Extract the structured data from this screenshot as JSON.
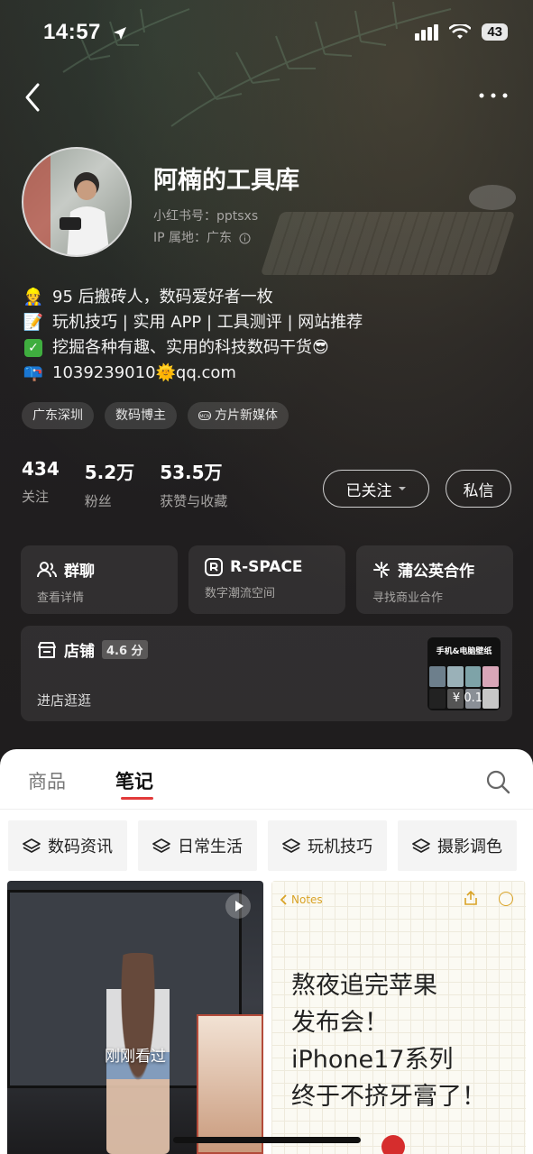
{
  "status_bar": {
    "time": "14:57",
    "battery": "43"
  },
  "profile": {
    "name": "阿楠的工具库",
    "red_id": "小红书号：pptsxs",
    "ip": "IP 属地：广东",
    "bio": [
      {
        "icon": "construction-worker-emoji",
        "text": "95 后搬砖人，数码爱好者一枚"
      },
      {
        "icon": "memo-emoji",
        "text": "玩机技巧 | 实用 APP | 工具测评 |  网站推荐"
      },
      {
        "icon": "check-mark-emoji",
        "text": "挖掘各种有趣、实用的科技数码干货😎"
      },
      {
        "icon": "mailbox-emoji",
        "text": "1039239010🌞qq.com"
      }
    ],
    "tags": [
      "广东深圳",
      "数码博主",
      "方片新媒体"
    ]
  },
  "stats": [
    {
      "value": "434",
      "label": "关注"
    },
    {
      "value": "5.2万",
      "label": "粉丝"
    },
    {
      "value": "53.5万",
      "label": "获赞与收藏"
    }
  ],
  "buttons": {
    "follow": "已关注",
    "message": "私信"
  },
  "cards": [
    {
      "icon": "people-icon",
      "title": "群聊",
      "subtitle": "查看详情"
    },
    {
      "icon": "r-space-icon",
      "title": "R-SPACE",
      "subtitle": "数字潮流空间"
    },
    {
      "icon": "dandelion-icon",
      "title": "蒲公英合作",
      "subtitle": "寻找商业合作"
    }
  ],
  "shop": {
    "title": "店铺",
    "rating": "4.6 分",
    "enter": "进店逛逛",
    "thumb_title": "手机&电脑壁纸",
    "thumb_price": "¥ 0.1"
  },
  "tabs": {
    "goods": "商品",
    "notes": "笔记"
  },
  "categories": [
    "数码资讯",
    "日常生活",
    "玩机技巧",
    "摄影调色"
  ],
  "notes": [
    {
      "overlay": "刚刚看过"
    },
    {
      "header": "Notes",
      "text": "熬夜追完苹果\n发布会！\niPhone17系列\n终于不挤牙膏了！"
    }
  ],
  "colors": {
    "accent": "#e23a3a",
    "panel_bg": "#ffffff",
    "profile_bg": "#1e1c1d"
  }
}
